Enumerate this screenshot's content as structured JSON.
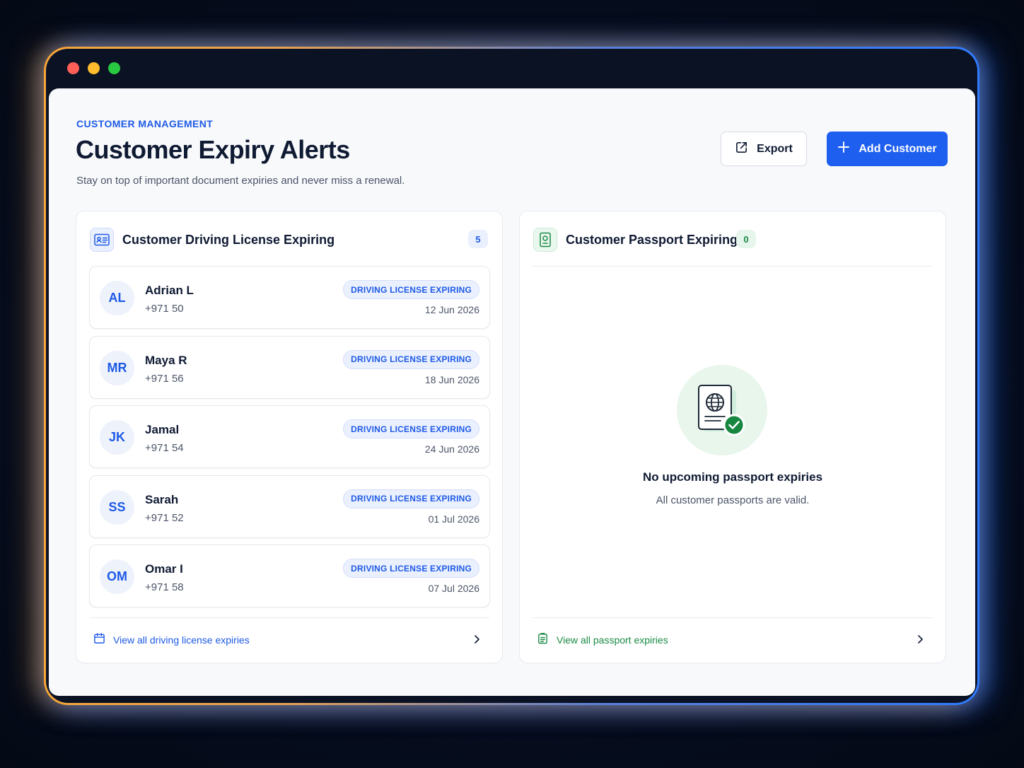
{
  "header": {
    "eyebrow": "CUSTOMER MANAGEMENT",
    "title": "Customer Expiry Alerts",
    "subtitle": "Stay on top of important document expiries and never miss a renewal.",
    "export_label": "Export",
    "add_customer_label": "Add Customer"
  },
  "license_panel": {
    "title": "Customer Driving License Expiring",
    "count": "5",
    "customers": [
      {
        "initials": "AL",
        "name": "Adrian L",
        "phone": "+971 50",
        "status": "DRIVING LICENSE EXPIRING",
        "date": "12 Jun 2026"
      },
      {
        "initials": "MR",
        "name": "Maya R",
        "phone": "+971 56",
        "status": "DRIVING LICENSE EXPIRING",
        "date": "18 Jun 2026"
      },
      {
        "initials": "JK",
        "name": "Jamal",
        "phone": "+971 54",
        "status": "DRIVING LICENSE EXPIRING",
        "date": "24 Jun 2026"
      },
      {
        "initials": "SS",
        "name": "Sarah",
        "phone": "+971 52",
        "status": "DRIVING LICENSE EXPIRING",
        "date": "01 Jul 2026"
      },
      {
        "initials": "OM",
        "name": "Omar I",
        "phone": "+971 58",
        "status": "DRIVING LICENSE EXPIRING",
        "date": "07 Jul 2026"
      }
    ],
    "footer_link": "View all driving license expiries"
  },
  "passport_panel": {
    "title": "Customer Passport Expiring",
    "count": "0",
    "empty_title": "No upcoming passport expiries",
    "empty_desc": "All customer passports are valid.",
    "footer_link": "View all passport expiries"
  },
  "colors": {
    "accent_blue": "#1e5ff0",
    "success_green": "#1a8a45",
    "traffic_red": "#ff5f57",
    "traffic_yellow": "#febc2e",
    "traffic_green": "#28c840"
  }
}
